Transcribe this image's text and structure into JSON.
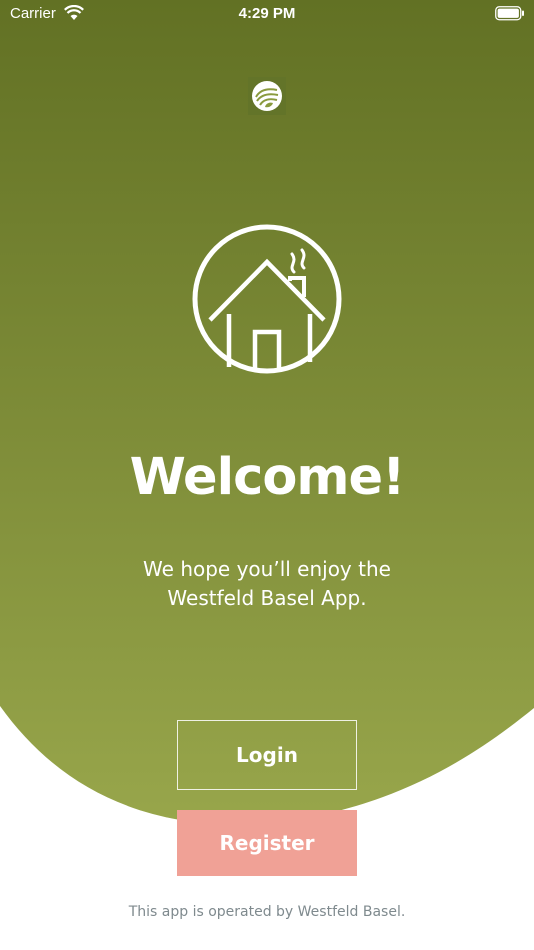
{
  "status_bar": {
    "carrier": "Carrier",
    "time": "4:29 PM",
    "wifi_icon": "wifi-icon",
    "battery_icon": "battery-icon"
  },
  "brand": {
    "logo_icon": "westfeld-logo-icon"
  },
  "hero": {
    "icon": "house-icon",
    "title": "Welcome!",
    "subtitle": "We hope you’ll enjoy the Westfeld Basel App."
  },
  "actions": {
    "login_label": "Login",
    "register_label": "Register"
  },
  "footer": {
    "text": "This app is operated by Westfeld Basel."
  },
  "colors": {
    "gradient_top": "#627124",
    "gradient_bottom": "#98a64b",
    "register_button": "#f0a196",
    "footer_text": "#7f8a8e",
    "background": "#ffffff"
  }
}
